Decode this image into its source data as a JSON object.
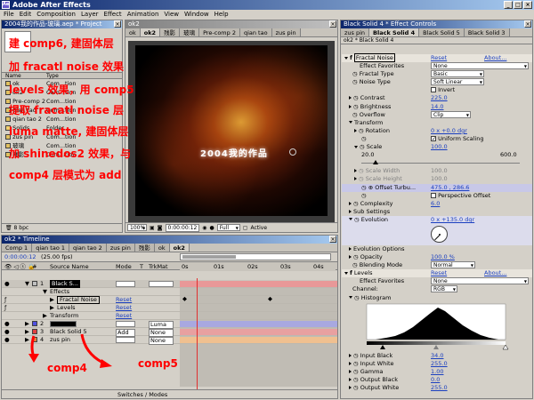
{
  "app": {
    "title": "Adobe After Effects",
    "icon": "Ae"
  },
  "menu": [
    "File",
    "Edit",
    "Composition",
    "Layer",
    "Effect",
    "Animation",
    "View",
    "Window",
    "Help"
  ],
  "project": {
    "title": "2004我的作品-玻璃.aep * Project",
    "columns": [
      "Name",
      "Type"
    ],
    "items": [
      {
        "name": "ok",
        "type": "Com...tion"
      },
      {
        "name": "ok2",
        "type": "Com...tion"
      },
      {
        "name": "Pre-comp 2",
        "type": "Com...tion"
      },
      {
        "name": "qian tao",
        "type": "Com...tion"
      },
      {
        "name": "qian tao 2",
        "type": "Com...tion"
      },
      {
        "name": "Solids",
        "type": "Folder"
      },
      {
        "name": "zus pin",
        "type": "Com...tion"
      },
      {
        "name": "玻璃",
        "type": "Com...tion"
      },
      {
        "name": "残影",
        "type": "Com...tion"
      }
    ],
    "bpc": "8 bpc"
  },
  "annotations": {
    "a1": "建 comp6, 建固体层",
    "a2": "加 fracatl noise 效果",
    "a3": "levels 效果，用 comp5",
    "a4": "提取 fracatl noise 层",
    "a5": "luma matte, 建固体层",
    "a6": "加 shinedos2 效果，与",
    "a7": "comp4 层模式为 add",
    "comp4": "comp4",
    "comp5": "comp5"
  },
  "composition": {
    "title": "ok2",
    "tabs": [
      "ok",
      "ok2",
      "残影",
      "玻璃",
      "Pre-comp 2",
      "qian tao",
      "zus pin"
    ],
    "overlay_text": "2004我的作品",
    "zoom": "100%",
    "timecode": "0:00:00:12",
    "resolution": "Full",
    "view": "Active"
  },
  "effect_controls": {
    "title": "Black Solid 4 * Effect Controls",
    "tabs": [
      "zus pin",
      "Black Solid 4",
      "Black Solid 5",
      "Black Solid 3"
    ],
    "breadcrumb": "ok2 * Black Solid 4",
    "fractal": {
      "name": "Fractal Noise",
      "reset": "Reset",
      "about": "About...",
      "favorites_label": "Effect Favorites",
      "favorites_value": "None",
      "fractal_type_label": "Fractal Type",
      "fractal_type": "Basic",
      "noise_type_label": "Noise Type",
      "noise_type": "Soft Linear",
      "invert": "Invert",
      "contrast_label": "Contrast",
      "contrast": "225.0",
      "brightness_label": "Brightness",
      "brightness": "14.0",
      "overflow_label": "Overflow",
      "overflow": "Clip",
      "transform": "Transform",
      "rotation_label": "Rotation",
      "rotation": "0 x +0.0 dgr",
      "uniform": "Uniform Scaling",
      "scale_label": "Scale",
      "scale": "100.0",
      "scale_min": "20.0",
      "scale_max": "600.0",
      "scale_width_label": "Scale Width",
      "scale_width": "100.0",
      "scale_height_label": "Scale Height",
      "scale_height": "100.0",
      "offset_label": "Offset Turbu...",
      "offset": "475.0 , 286.6",
      "perspective": "Perspective Offset",
      "complexity_label": "Complexity",
      "complexity": "6.0",
      "sub_settings": "Sub Settings",
      "evolution_label": "Evolution",
      "evolution": "0 x +135.0 dgr",
      "evolution_options": "Evolution Options",
      "opacity_label": "Opacity",
      "opacity": "100.0 %",
      "blending_label": "Blending Mode",
      "blending": "Normal"
    },
    "levels": {
      "name": "Levels",
      "reset": "Reset",
      "about": "About...",
      "favorites_label": "Effect Favorites",
      "favorites_value": "None",
      "channel_label": "Channel:",
      "channel": "RGB",
      "histogram": "Histogram",
      "input_black_label": "Input Black",
      "input_black": "34.0",
      "input_white_label": "Input White",
      "input_white": "255.0",
      "gamma_label": "Gamma",
      "gamma": "1.00",
      "output_black_label": "Output Black",
      "output_black": "0.0",
      "output_white_label": "Output White",
      "output_white": "255.0"
    }
  },
  "timeline": {
    "title": "ok2 * Timeline",
    "tabs": [
      "Comp 1",
      "qian tao 1",
      "qian tao 2",
      "zus pin",
      "残影",
      "ok",
      "ok2"
    ],
    "timecode": "0:00:00:12",
    "fps": "(25.00 fps)",
    "columns": {
      "source": "Source Name",
      "mode": "Mode",
      "t": "T",
      "trkmat": "TrkMat"
    },
    "ruler": [
      "0s",
      "01s",
      "02s",
      "03s",
      "04s"
    ],
    "layers": [
      {
        "num": "1",
        "name": "Black S...",
        "mode": "",
        "trkmat": "",
        "color": "#c0c0c0",
        "selected": true
      },
      {
        "num": "",
        "name": "Effects",
        "indent": 1
      },
      {
        "num": "",
        "name": "Fractal Noise",
        "reset": "Reset",
        "indent": 2,
        "boxed": true
      },
      {
        "num": "",
        "name": "Levels",
        "reset": "Reset",
        "indent": 2
      },
      {
        "num": "",
        "name": "Transform",
        "reset": "Reset",
        "indent": 1
      },
      {
        "num": "2",
        "name": "",
        "mode": "",
        "trkmat": "Luma",
        "color": "#5050e0"
      },
      {
        "num": "3",
        "name": "Black Solid 5",
        "mode": "Add",
        "trkmat": "None",
        "color": "#e04040"
      },
      {
        "num": "4",
        "name": "zus pin",
        "mode": "",
        "trkmat": "None",
        "color": "#e08040"
      }
    ],
    "footer": "Switches / Modes"
  }
}
